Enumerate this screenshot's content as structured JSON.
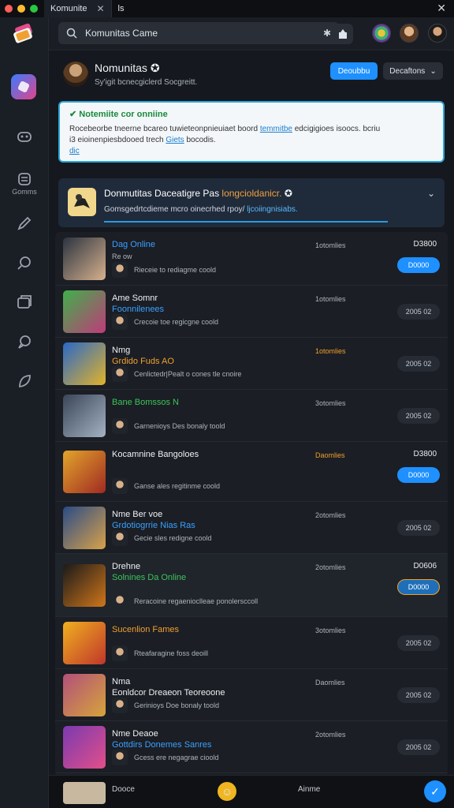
{
  "titlebar": {
    "tab_active": "Komunite",
    "tab_second": "ls"
  },
  "search": {
    "value": "Komunitas Came"
  },
  "sidebar": {
    "items": [
      {
        "label": ""
      },
      {
        "label": "Gomms"
      },
      {
        "label": ""
      },
      {
        "label": ""
      },
      {
        "label": ""
      },
      {
        "label": ""
      },
      {
        "label": ""
      }
    ]
  },
  "header": {
    "title": "Nomunitas",
    "subtitle": "Sy'igit bcnecgiclerd Socgreitt.",
    "primary_label": "Deoubbu",
    "dropdown_label": "Decaftons"
  },
  "alert": {
    "title": "Notemiite cor onniine",
    "text1": "Rocebeorbe tneerne bcareo tuwieteonpnieuiaet boord",
    "link1": "temmitbe",
    "text2": "edcigigioes isoocs. bcriu",
    "text3": "i3 eioinenpiesbdooed trech",
    "link2": "Giets",
    "text4": "bocodis.",
    "text5": "dic"
  },
  "promo": {
    "title": "Donmutitas Daceatigre Pas",
    "title_hi": "longcioldanicr.",
    "text": "Gomsgedrtcdieme mcro oinecrhed rpoy/",
    "text_hi": "ljcoiingnisiabs."
  },
  "rows": [
    {
      "title": "Dag Online",
      "title_color": "#3aa0ff",
      "sub": "Re ow",
      "meta": "Rieceie to rediagme coold",
      "time": "1otomlies",
      "stat": "D3800",
      "btn": "D0000",
      "btn_type": "join"
    },
    {
      "title": "Ame Somnr",
      "title2": "Foonnilenees",
      "title2_color": "#3aa0ff",
      "meta": "Crecoie toe regicgne coold",
      "time": "1otomlies",
      "stat": "",
      "btn": "2005 02",
      "btn_type": "sec"
    },
    {
      "title": "Nmg",
      "title2": "Grdido Fuds AO",
      "title2_color": "#f0a030",
      "meta": "Cenlictedr|Pealt o cones tle cnoire",
      "time": "1otomlies",
      "time_color": "#f0a030",
      "stat": "",
      "btn": "2005 02",
      "btn_type": "sec"
    },
    {
      "title": "Bane Bomssos N",
      "title_color": "#3bc45a",
      "meta": "Garnenioys Des bonaly toold",
      "time": "3otomlies",
      "stat": "",
      "btn": "2005 02",
      "btn_type": "sec"
    },
    {
      "title": "Kocamnine Bangoloes",
      "meta": "Ganse ales regitinme coold",
      "time": "Daomlies",
      "time_color": "#f0a030",
      "stat": "D3800",
      "btn": "D0000",
      "btn_type": "join"
    },
    {
      "title": "Nme Ber voe",
      "title2": "Grdotiogrrie Nias Ras",
      "title2_color": "#3aa0ff",
      "meta": "Gecie sles redigne coold",
      "time": "2otomlies",
      "stat": "",
      "btn": "2005 02",
      "btn_type": "sec"
    },
    {
      "title": "Drehne",
      "title2": "Solnines Da Online",
      "title2_color": "#3bc45a",
      "meta": "Reracoine regaenioclleae ponolersccoll",
      "time": "2otomlies",
      "stat": "D0606",
      "btn": "D0000",
      "btn_type": "join"
    },
    {
      "title": "Sucenlion Fames",
      "title_color": "#f0a030",
      "meta": "Rteafaragine foss deoill",
      "time": "3otomlies",
      "stat": "",
      "btn": "2005 02",
      "btn_type": "sec"
    },
    {
      "title": "Nma",
      "title2": "Eonldcor Dreaeon Teoreoone",
      "title2_color": "#eef0f3",
      "meta": "Gerinioys Doe bonaly toold",
      "time": "Daomlies",
      "stat": "",
      "btn": "2005 02",
      "btn_type": "sec"
    },
    {
      "title": "Nme Deaoe",
      "title2": "Gottdirs Donemes Sanres",
      "title2_color": "#3aa0ff",
      "meta": "Gcess ere negagrae cioold",
      "time": "2otomlies",
      "stat": "",
      "btn": "2005 02",
      "btn_type": "sec"
    }
  ],
  "bottombar": {
    "left": "Dooce",
    "mid": "Ainme"
  }
}
